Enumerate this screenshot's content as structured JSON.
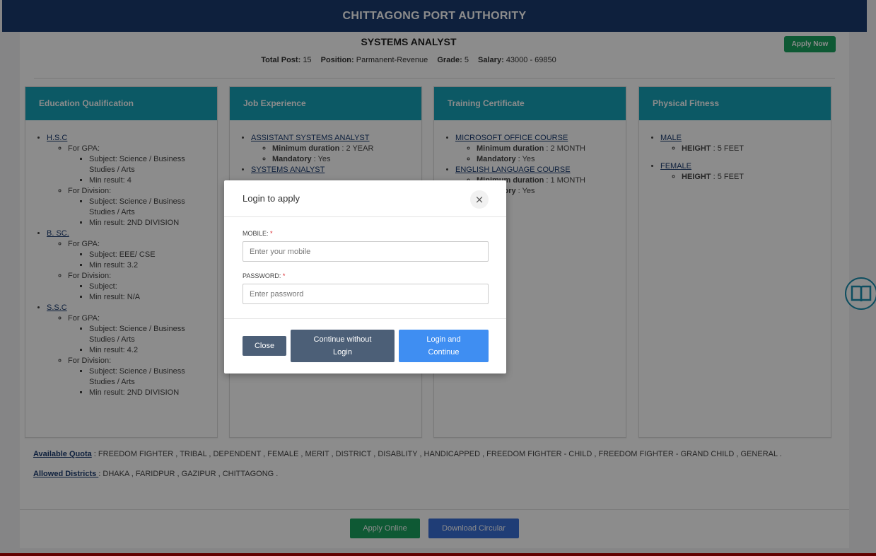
{
  "header": {
    "title": "CHITTAGONG PORT AUTHORITY"
  },
  "job": {
    "title": "SYSTEMS ANALYST",
    "apply_now": "Apply Now",
    "total_post_label": "Total Post:",
    "total_post": "15",
    "position_label": "Position:",
    "position": "Parmanent-Revenue",
    "grade_label": "Grade:",
    "grade": "5",
    "salary_label": "Salary:",
    "salary": "43000 - 69850"
  },
  "education": {
    "heading": "Education Qualification",
    "items": [
      {
        "name": "H.S.C",
        "gpa_label": "For GPA:",
        "gpa_subject": "Subject: Science / Business Studies / Arts",
        "gpa_result": "Min result: 4",
        "div_label": "For Division:",
        "div_subject": "Subject: Science / Business Studies / Arts",
        "div_result": "Min result: 2ND DIVISION"
      },
      {
        "name": "B. SC.",
        "gpa_label": "For GPA:",
        "gpa_subject": "Subject: EEE/ CSE",
        "gpa_result": "Min result: 3.2",
        "div_label": "For Division:",
        "div_subject": "Subject:",
        "div_result": "Min result: N/A"
      },
      {
        "name": "S.S.C",
        "gpa_label": "For GPA:",
        "gpa_subject": "Subject: Science / Business Studies / Arts",
        "gpa_result": "Min result: 4.2",
        "div_label": "For Division:",
        "div_subject": "Subject: Science / Business Studies / Arts",
        "div_result": "Min result: 2ND DIVISION"
      }
    ]
  },
  "experience": {
    "heading": "Job Experience",
    "items": [
      {
        "name": "ASSISTANT SYSTEMS ANALYST",
        "min_label": "Minimum duration",
        "min_value": " : 2 YEAR",
        "mand_label": "Mandatory",
        "mand_value": " : Yes"
      },
      {
        "name": "SYSTEMS ANALYST"
      }
    ]
  },
  "training": {
    "heading": "Training Certificate",
    "items": [
      {
        "name": "MICROSOFT OFFICE COURSE",
        "min_label": "Minimum duration",
        "min_value": " : 2 MONTH",
        "mand_label": "Mandatory",
        "mand_value": " : Yes"
      },
      {
        "name": "ENGLISH LANGUAGE COURSE",
        "min_label": "Minimum duration",
        "min_value": " : 1 MONTH",
        "mand_label": "Mandatory",
        "mand_value": " : Yes"
      }
    ]
  },
  "fitness": {
    "heading": "Physical Fitness",
    "items": [
      {
        "name": "MALE",
        "h_label": "HEIGHT",
        "h_value": " : 5 FEET"
      },
      {
        "name": "FEMALE",
        "h_label": "HEIGHT",
        "h_value": " : 5 FEET"
      }
    ]
  },
  "quota": {
    "label": "Available Quota",
    "value": " : FREEDOM FIGHTER , TRIBAL , DEPENDENT , FEMALE , MERIT , DISTRICT , DISABLITY , HANDICAPPED , FREEDOM FIGHTER - CHILD , FREEDOM FIGHTER - GRAND CHILD , GENERAL ."
  },
  "districts": {
    "label": "Allowed Districts ",
    "value": ": DHAKA , FARIDPUR , GAZIPUR , CHITTAGONG ."
  },
  "footer": {
    "apply_online": "Apply Online",
    "download": "Download Circular"
  },
  "modal": {
    "title": "Login to apply",
    "close_glyph": "×",
    "mobile_label": "MOBILE:",
    "mobile_placeholder": "Enter your mobile",
    "password_label": "PASSWORD:",
    "password_placeholder": "Enter password",
    "required": "*",
    "close_button": "Close",
    "continue_button": "Continue without Login",
    "login_button": "Login and Continue"
  },
  "colors": {
    "header": "#1b3b6f",
    "card_head": "#17a2b8",
    "green": "#1aa260",
    "blue": "#3f8ef2",
    "slate": "#4c5f77"
  }
}
